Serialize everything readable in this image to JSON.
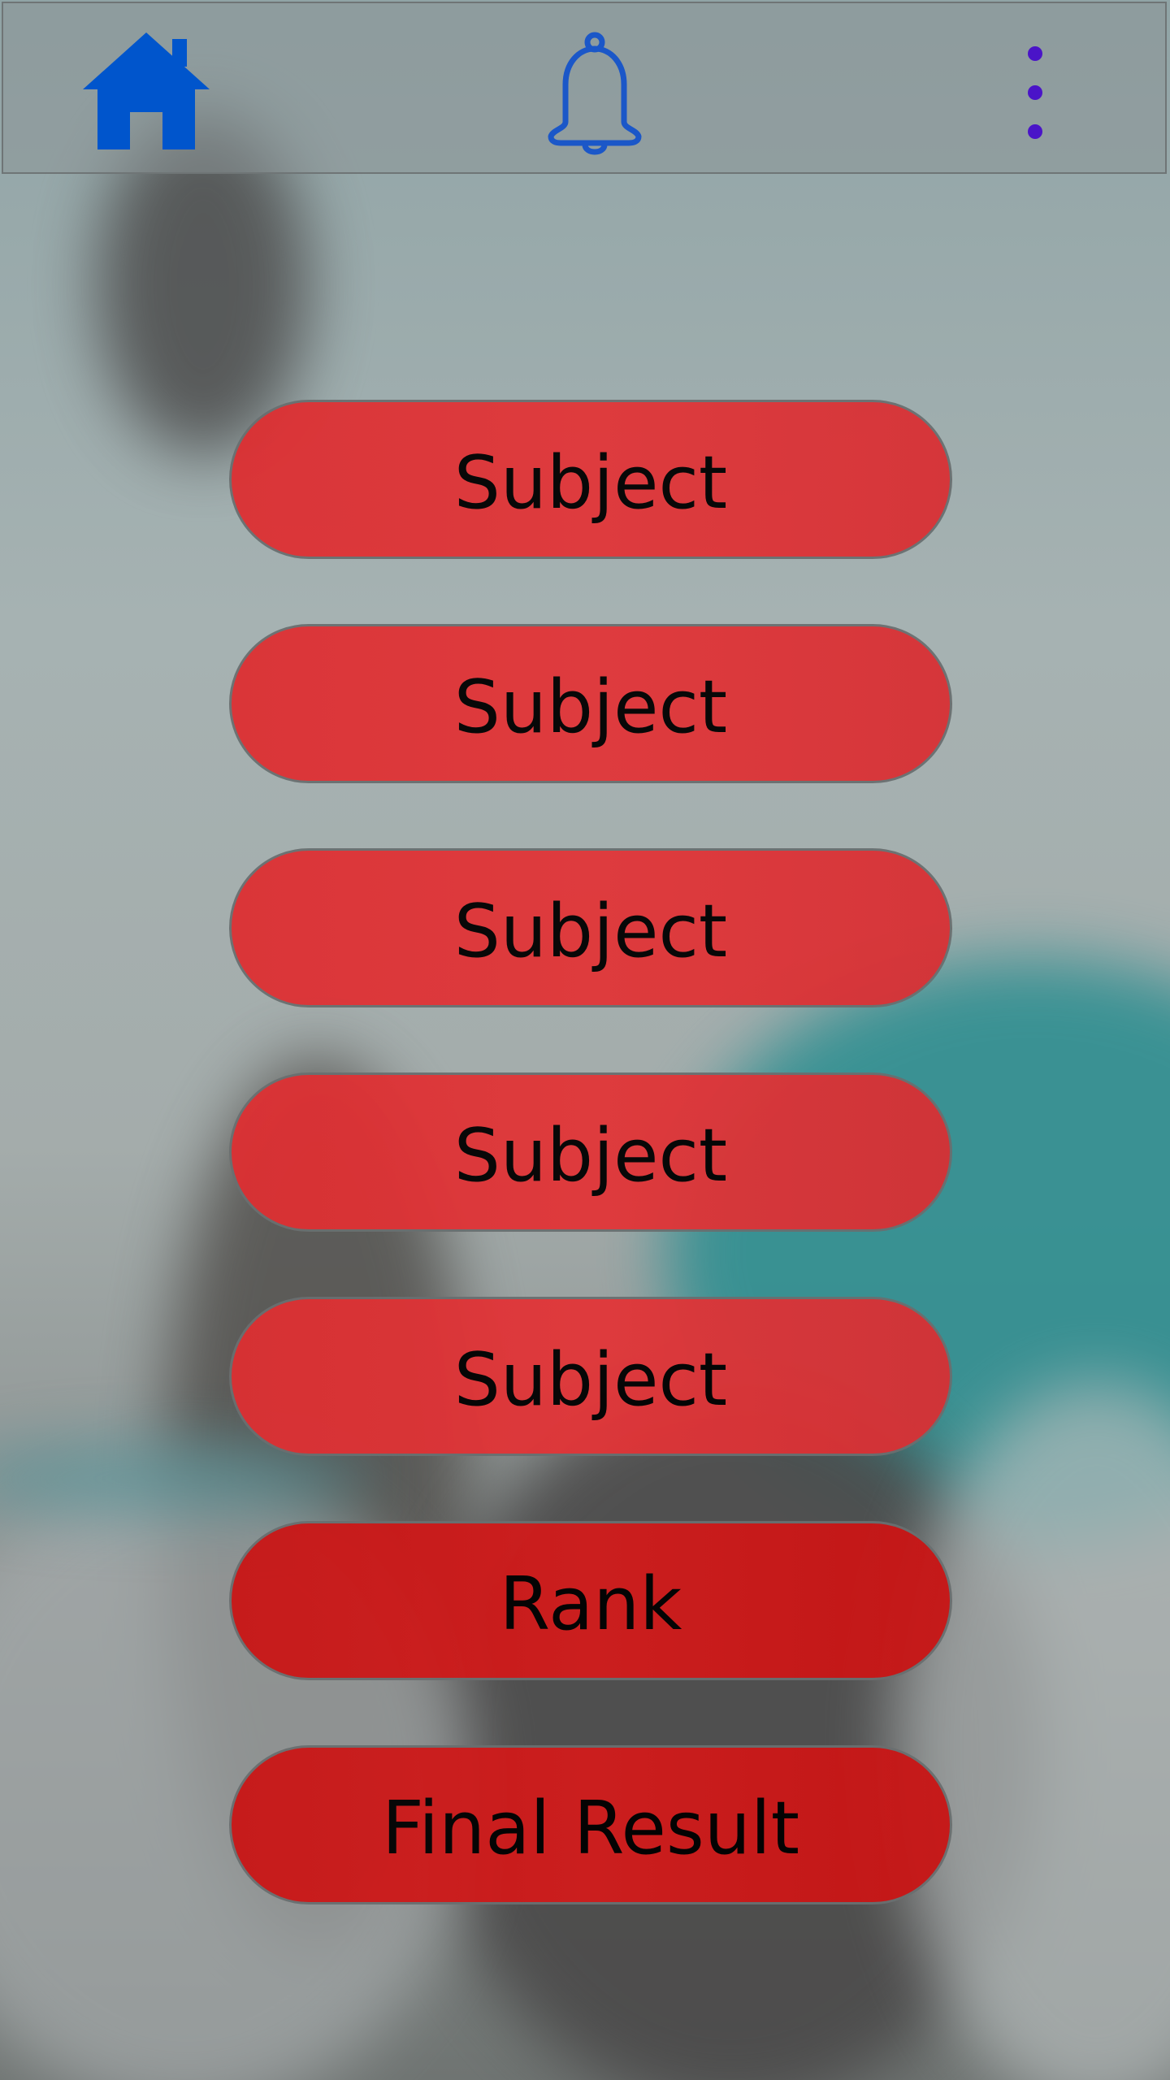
{
  "header": {
    "home_icon": "home-icon",
    "bell_icon": "bell-icon",
    "more_icon": "more-vertical-icon",
    "colors": {
      "home": "#0055cc",
      "bell": "#1b57c8",
      "more": "#4a14c8"
    }
  },
  "menu": {
    "items": [
      {
        "label": "Subject"
      },
      {
        "label": "Subject"
      },
      {
        "label": "Subject"
      },
      {
        "label": "Subject"
      },
      {
        "label": "Subject"
      },
      {
        "label": "Rank"
      },
      {
        "label": "Final Result"
      }
    ],
    "button_color": "#e03538"
  }
}
